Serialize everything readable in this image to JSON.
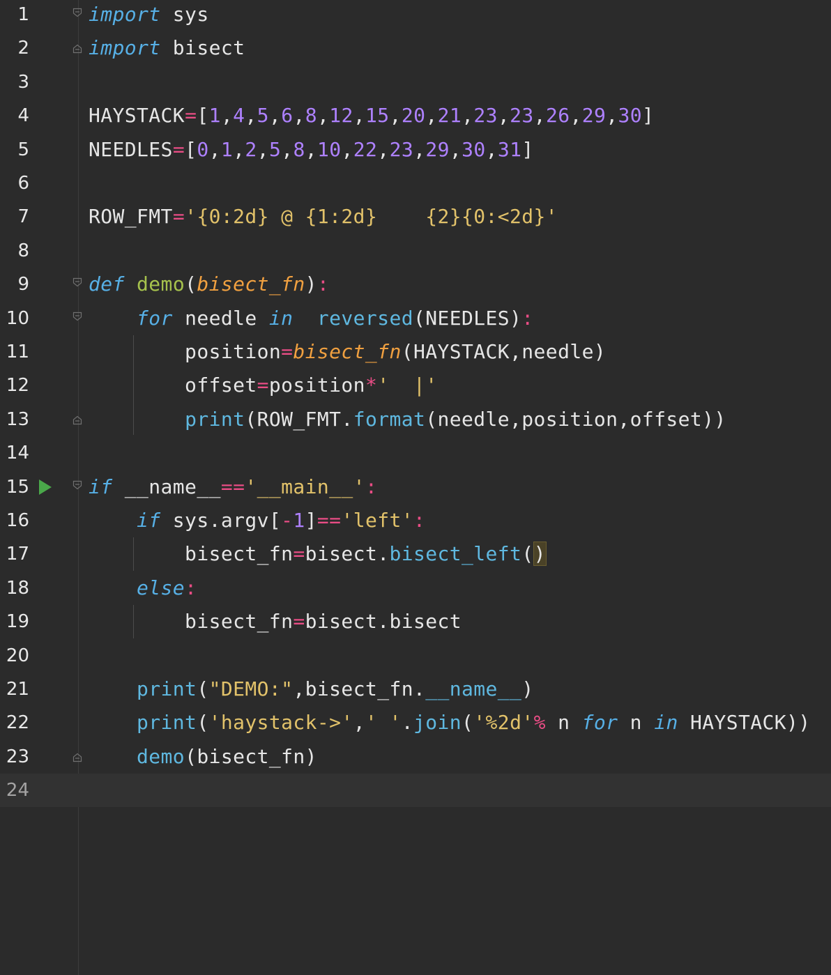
{
  "editor": {
    "language": "python",
    "current_line": 24,
    "lines": [
      {
        "n": "1",
        "segments": [
          [
            "kw",
            "import"
          ],
          [
            "id",
            " sys"
          ]
        ]
      },
      {
        "n": "2",
        "segments": [
          [
            "kw",
            "import"
          ],
          [
            "id",
            " bisect"
          ]
        ]
      },
      {
        "n": "3",
        "segments": []
      },
      {
        "n": "4",
        "segments": [
          [
            "id",
            "HAYSTACK"
          ],
          [
            "op",
            "="
          ],
          [
            "id",
            "["
          ],
          [
            "num",
            "1"
          ],
          [
            "id",
            ","
          ],
          [
            "num",
            "4"
          ],
          [
            "id",
            ","
          ],
          [
            "num",
            "5"
          ],
          [
            "id",
            ","
          ],
          [
            "num",
            "6"
          ],
          [
            "id",
            ","
          ],
          [
            "num",
            "8"
          ],
          [
            "id",
            ","
          ],
          [
            "num",
            "12"
          ],
          [
            "id",
            ","
          ],
          [
            "num",
            "15"
          ],
          [
            "id",
            ","
          ],
          [
            "num",
            "20"
          ],
          [
            "id",
            ","
          ],
          [
            "num",
            "21"
          ],
          [
            "id",
            ","
          ],
          [
            "num",
            "23"
          ],
          [
            "id",
            ","
          ],
          [
            "num",
            "23"
          ],
          [
            "id",
            ","
          ],
          [
            "num",
            "26"
          ],
          [
            "id",
            ","
          ],
          [
            "num",
            "29"
          ],
          [
            "id",
            ","
          ],
          [
            "num",
            "30"
          ],
          [
            "id",
            "]"
          ]
        ]
      },
      {
        "n": "5",
        "segments": [
          [
            "id",
            "NEEDLES"
          ],
          [
            "op",
            "="
          ],
          [
            "id",
            "["
          ],
          [
            "num",
            "0"
          ],
          [
            "id",
            ","
          ],
          [
            "num",
            "1"
          ],
          [
            "id",
            ","
          ],
          [
            "num",
            "2"
          ],
          [
            "id",
            ","
          ],
          [
            "num",
            "5"
          ],
          [
            "id",
            ","
          ],
          [
            "num",
            "8"
          ],
          [
            "id",
            ","
          ],
          [
            "num",
            "10"
          ],
          [
            "id",
            ","
          ],
          [
            "num",
            "22"
          ],
          [
            "id",
            ","
          ],
          [
            "num",
            "23"
          ],
          [
            "id",
            ","
          ],
          [
            "num",
            "29"
          ],
          [
            "id",
            ","
          ],
          [
            "num",
            "30"
          ],
          [
            "id",
            ","
          ],
          [
            "num",
            "31"
          ],
          [
            "id",
            "]"
          ]
        ]
      },
      {
        "n": "6",
        "segments": []
      },
      {
        "n": "7",
        "segments": [
          [
            "id",
            "ROW_FMT"
          ],
          [
            "op",
            "="
          ],
          [
            "str",
            "'{0:2d} @ {1:2d}    {2}{0:<2d}'"
          ]
        ]
      },
      {
        "n": "8",
        "segments": []
      },
      {
        "n": "9",
        "segments": [
          [
            "kw",
            "def"
          ],
          [
            "id",
            " "
          ],
          [
            "fn",
            "demo"
          ],
          [
            "id",
            "("
          ],
          [
            "param",
            "bisect_fn"
          ],
          [
            "id",
            ")"
          ],
          [
            "op",
            ":"
          ]
        ]
      },
      {
        "n": "10",
        "segments": [
          [
            "id",
            "    "
          ],
          [
            "kw",
            "for"
          ],
          [
            "id",
            " needle "
          ],
          [
            "kw",
            "in"
          ],
          [
            "id",
            "  "
          ],
          [
            "bi",
            "reversed"
          ],
          [
            "id",
            "(NEEDLES)"
          ],
          [
            "op",
            ":"
          ]
        ]
      },
      {
        "n": "11",
        "segments": [
          [
            "id",
            "        position"
          ],
          [
            "op",
            "="
          ],
          [
            "param",
            "bisect_fn"
          ],
          [
            "id",
            "(HAYSTACK,needle)"
          ]
        ]
      },
      {
        "n": "12",
        "segments": [
          [
            "id",
            "        offset"
          ],
          [
            "op",
            "="
          ],
          [
            "id",
            "position"
          ],
          [
            "op",
            "*"
          ],
          [
            "str",
            "'  |'"
          ]
        ]
      },
      {
        "n": "13",
        "segments": [
          [
            "id",
            "        "
          ],
          [
            "bi",
            "print"
          ],
          [
            "id",
            "(ROW_FMT."
          ],
          [
            "bi",
            "format"
          ],
          [
            "id",
            "(needle,position,offset))"
          ]
        ]
      },
      {
        "n": "14",
        "segments": []
      },
      {
        "n": "15",
        "segments": [
          [
            "kw",
            "if"
          ],
          [
            "id",
            " __name__"
          ],
          [
            "op",
            "=="
          ],
          [
            "str",
            "'__main__'"
          ],
          [
            "op",
            ":"
          ]
        ]
      },
      {
        "n": "16",
        "segments": [
          [
            "id",
            "    "
          ],
          [
            "kw",
            "if"
          ],
          [
            "id",
            " sys.argv["
          ],
          [
            "op",
            "-"
          ],
          [
            "num",
            "1"
          ],
          [
            "id",
            "]"
          ],
          [
            "op",
            "=="
          ],
          [
            "str",
            "'left'"
          ],
          [
            "op",
            ":"
          ]
        ]
      },
      {
        "n": "17",
        "segments": [
          [
            "id",
            "        bisect_fn"
          ],
          [
            "op",
            "="
          ],
          [
            "id",
            "bisect."
          ],
          [
            "bi",
            "bisect_left"
          ],
          [
            "id",
            "("
          ],
          [
            "match",
            ")"
          ]
        ]
      },
      {
        "n": "18",
        "segments": [
          [
            "id",
            "    "
          ],
          [
            "kw",
            "else"
          ],
          [
            "op",
            ":"
          ]
        ]
      },
      {
        "n": "19",
        "segments": [
          [
            "id",
            "        bisect_fn"
          ],
          [
            "op",
            "="
          ],
          [
            "id",
            "bisect.bisect"
          ]
        ]
      },
      {
        "n": "20",
        "segments": []
      },
      {
        "n": "21",
        "segments": [
          [
            "id",
            "    "
          ],
          [
            "bi",
            "print"
          ],
          [
            "id",
            "("
          ],
          [
            "str",
            "\"DEMO:\""
          ],
          [
            "id",
            ",bisect_fn."
          ],
          [
            "bi",
            "__name__"
          ],
          [
            "id",
            ")"
          ]
        ]
      },
      {
        "n": "22",
        "segments": [
          [
            "id",
            "    "
          ],
          [
            "bi",
            "print"
          ],
          [
            "id",
            "("
          ],
          [
            "str",
            "'haystack->'"
          ],
          [
            "id",
            ","
          ],
          [
            "str",
            "' '"
          ],
          [
            "id",
            "."
          ],
          [
            "bi",
            "join"
          ],
          [
            "id",
            "("
          ],
          [
            "str",
            "'%2d'"
          ],
          [
            "op",
            "%"
          ],
          [
            "id",
            " n "
          ],
          [
            "kw",
            "for"
          ],
          [
            "id",
            " n "
          ],
          [
            "kw",
            "in"
          ],
          [
            "id",
            " HAYSTACK))"
          ]
        ]
      },
      {
        "n": "23",
        "segments": [
          [
            "id",
            "    "
          ],
          [
            "bi",
            "demo"
          ],
          [
            "id",
            "(bisect_fn)"
          ]
        ]
      },
      {
        "n": "24",
        "segments": []
      }
    ],
    "fold_open_lines": [
      "1",
      "9",
      "10",
      "15"
    ],
    "fold_end_lines": [
      "2",
      "13",
      "23"
    ],
    "run_marker_line": "15",
    "colors": {
      "background": "#2b2b2b",
      "current_line": "#323232",
      "keyword": "#57b0e6",
      "function": "#a6c24d",
      "parameter": "#f0a040",
      "operator": "#e94d85",
      "number": "#ae81ff",
      "string": "#e2c26a",
      "builtin": "#5fb8e0",
      "text": "#e6e6e6",
      "run_icon": "#4aa84a"
    }
  }
}
